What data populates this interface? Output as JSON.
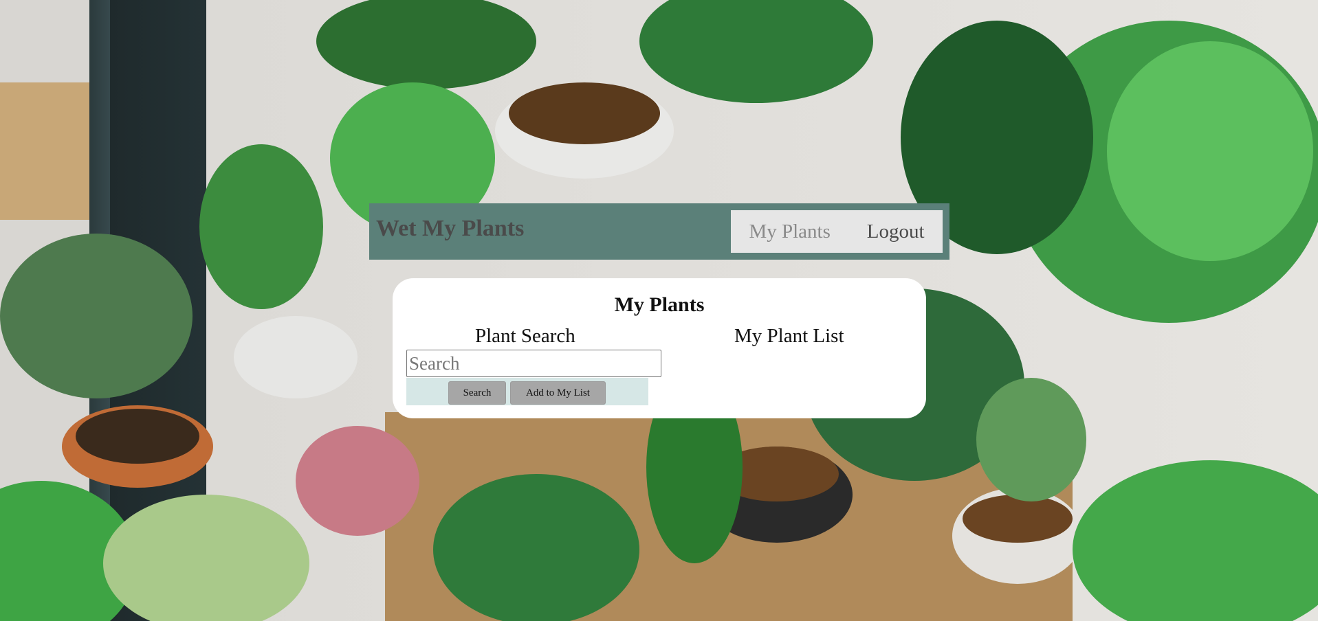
{
  "header": {
    "brand": "Wet My Plants",
    "nav": {
      "my_plants": "My Plants",
      "logout": "Logout"
    }
  },
  "main": {
    "title": "My Plants",
    "plant_search": {
      "heading": "Plant Search",
      "search_placeholder": "Search",
      "search_value": "",
      "search_button": "Search",
      "add_button": "Add to My List"
    },
    "plant_list": {
      "heading": "My Plant List",
      "items": []
    }
  },
  "colors": {
    "navbar": "#5b8079",
    "nav_links_bg": "#e6e6e6",
    "button": "#a6a6a6",
    "button_row_bg": "#d6e7e6"
  }
}
